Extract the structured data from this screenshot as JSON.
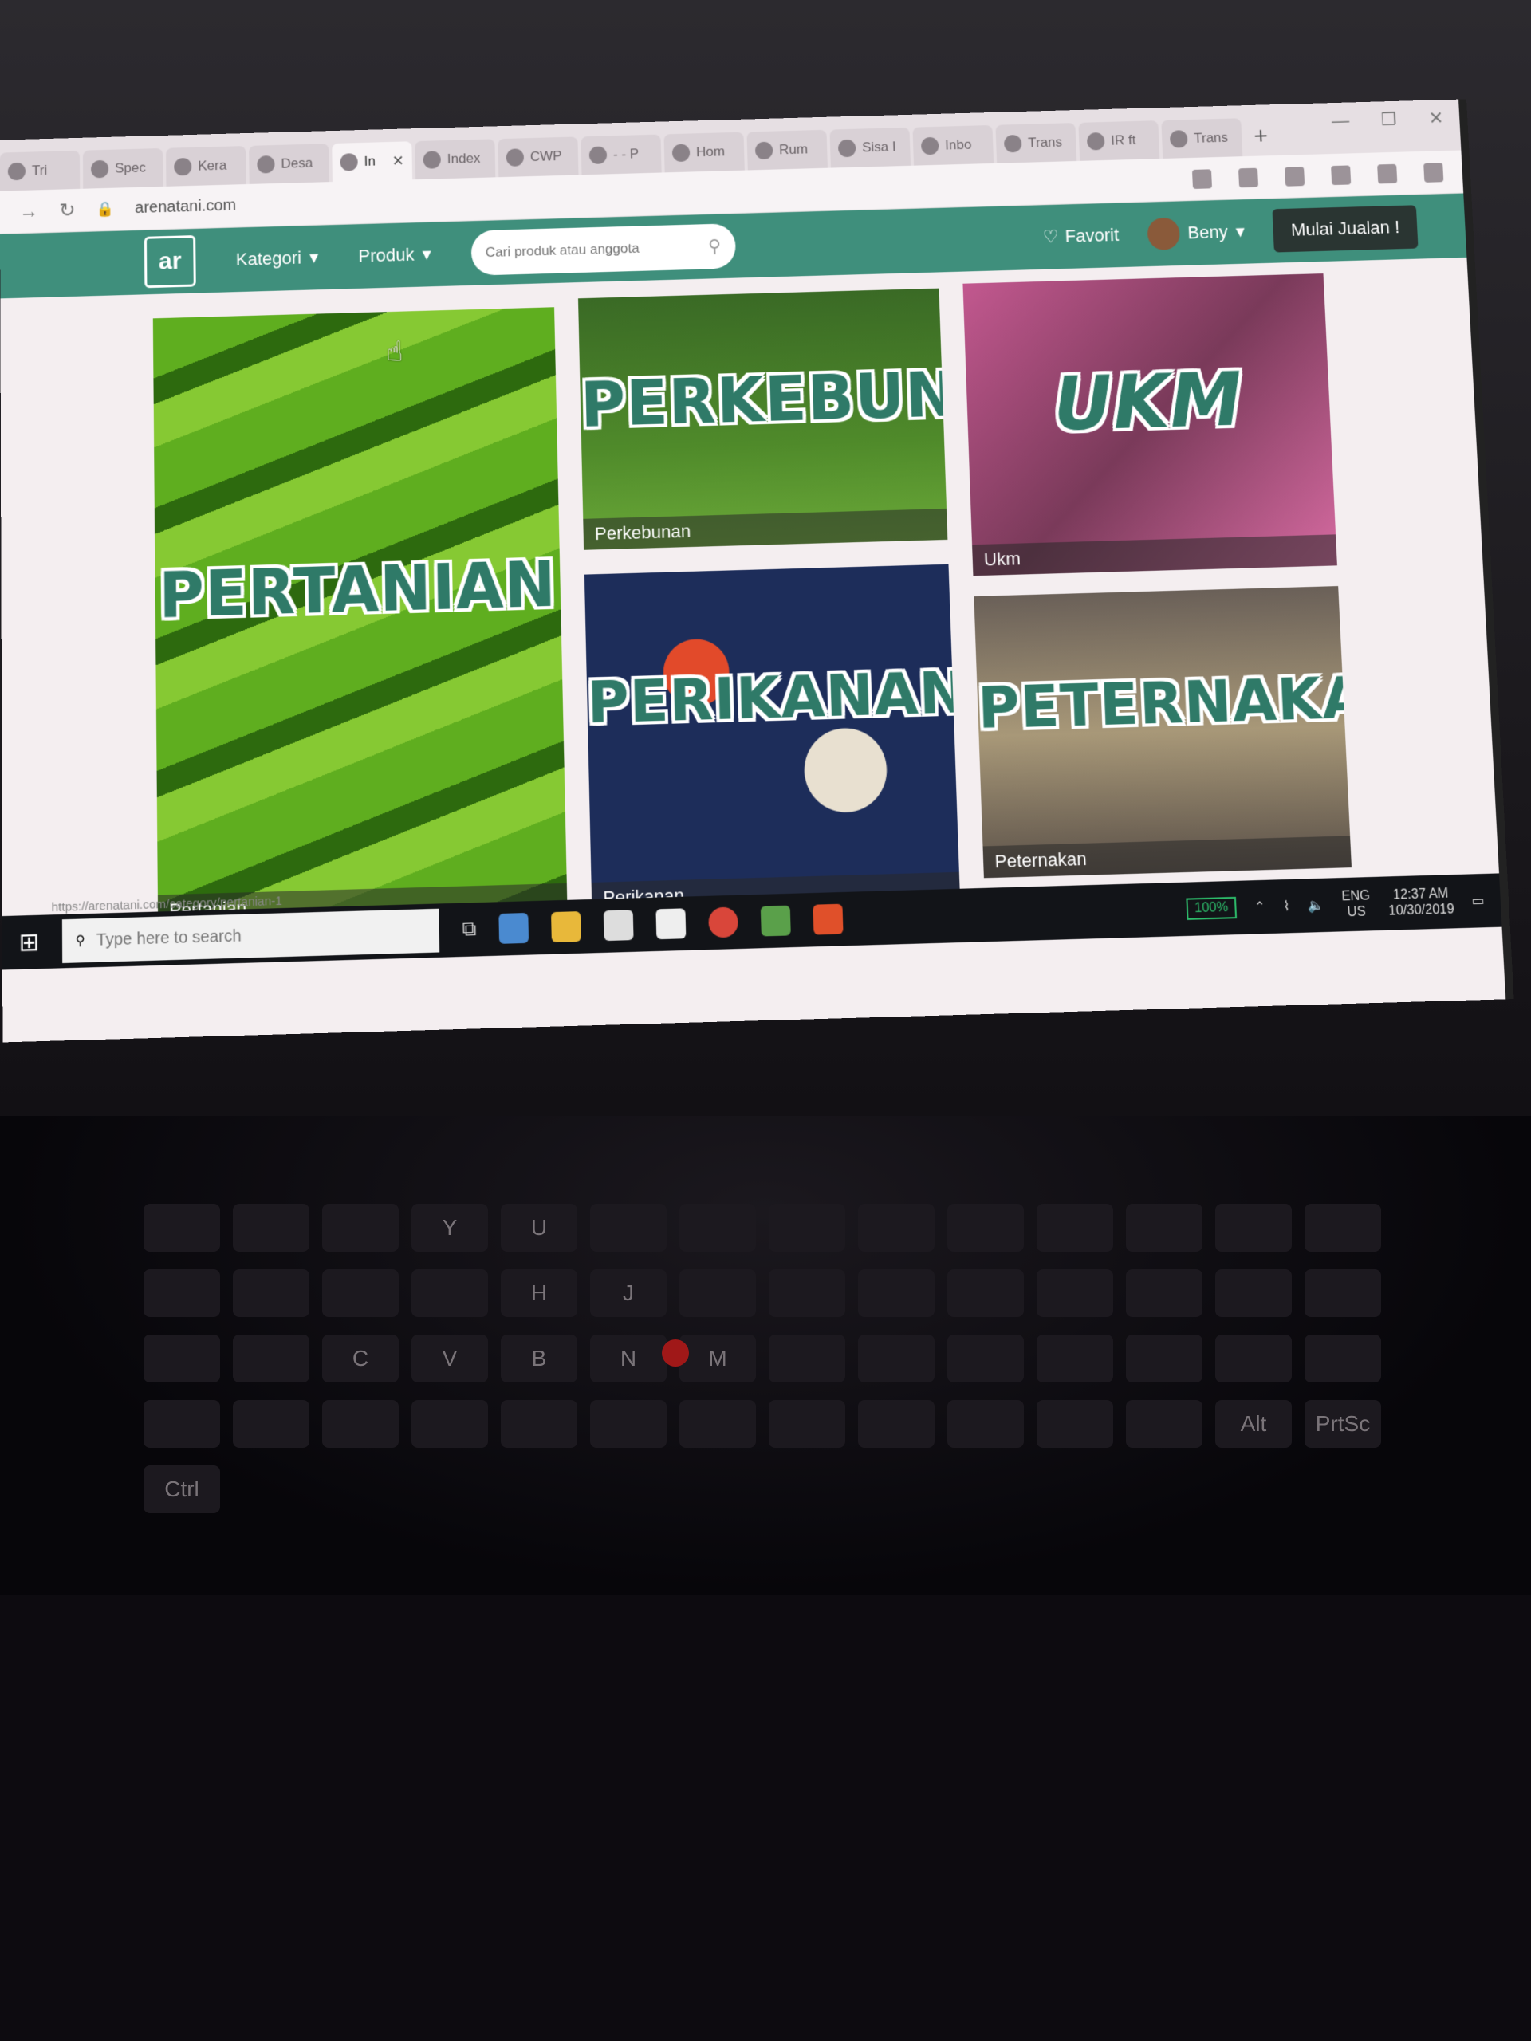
{
  "browser": {
    "tabs": [
      {
        "label": "Tri"
      },
      {
        "label": "Spec"
      },
      {
        "label": "Kera"
      },
      {
        "label": "Desa"
      },
      {
        "label": "In",
        "active": true
      },
      {
        "label": "Index"
      },
      {
        "label": "CWP"
      },
      {
        "label": "- - P"
      },
      {
        "label": "Hom"
      },
      {
        "label": "Rum"
      },
      {
        "label": "Sisa I"
      },
      {
        "label": "Inbo"
      },
      {
        "label": "Trans"
      },
      {
        "label": "IR ft"
      },
      {
        "label": "Trans"
      }
    ],
    "url": "arenatani.com",
    "status_url": "https://arenatani.com/category/pertanian-1"
  },
  "site": {
    "logo_text": "ar",
    "nav": {
      "kategori": "Kategori",
      "produk": "Produk",
      "search_placeholder": "Cari produk atau anggota",
      "favorit": "Favorit",
      "user_name": "Beny",
      "sell_button": "Mulai Jualan !"
    },
    "categories": [
      {
        "title": "PERTANIAN",
        "caption": "Pertanian"
      },
      {
        "title": "PERKEBUNAN",
        "caption": "Perkebunan"
      },
      {
        "title": "UKM",
        "caption": "Ukm"
      },
      {
        "title": "PERIKANAN",
        "caption": "Perikanan"
      },
      {
        "title": "PETERNAKAN",
        "caption": "Peternakan"
      }
    ]
  },
  "taskbar": {
    "search_placeholder": "Type here to search",
    "battery": "100%",
    "lang_top": "ENG",
    "lang_bottom": "US",
    "time": "12:37 AM",
    "date": "10/30/2019"
  },
  "keyboard": {
    "keys": [
      "Y",
      "U",
      "H",
      "J",
      "C",
      "V",
      "B",
      "N",
      "M",
      "Alt",
      "PrtSc",
      "Ctrl"
    ]
  },
  "colors": {
    "brand_green": "#3f8f7c",
    "sell_button_bg": "#2a3532"
  }
}
